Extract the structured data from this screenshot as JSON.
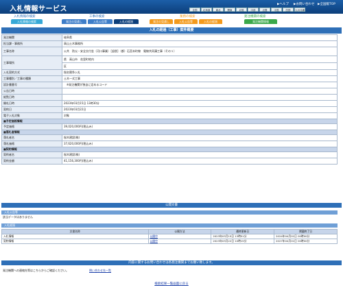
{
  "header": {
    "title": "入札情報サービス",
    "links": [
      "▶ヘルプ",
      "▶お問い合わせ",
      "▶全国版TOP"
    ],
    "regions": [
      "全国",
      "北海道",
      "東北",
      "関東",
      "北陸",
      "中部",
      "近畿",
      "中国",
      "四国",
      "九州沖縄"
    ]
  },
  "tabs": {
    "group_search": "入札情報の検索",
    "group_koji": "工事の検索",
    "group_gyomu": "業務の検索",
    "group_agency": "発注機関の検索",
    "items": [
      "入札情報の検索",
      "発注の見通し",
      "入札公告等",
      "入札の経過",
      "発注の見通し",
      "入札公告等",
      "入札の経過",
      "発注機関情報"
    ]
  },
  "page_title": "入札の経過（工事）案件概要",
  "details": [
    {
      "label": "発注機関",
      "value": "岐阜県"
    },
    {
      "label": "担当課・事務所",
      "value": "高山土木事務所"
    },
    {
      "label": "工事名称",
      "value": "公共　防災・安全交付金（河川事業）［認償］（都）石宮本町線　電線共同溝工事（その１）"
    },
    {
      "label": "工事場所",
      "value": "県　高山市　花里町地内"
    },
    {
      "label": "",
      "value": "区"
    },
    {
      "label": "入札契約方式",
      "value": "指名競争入札"
    },
    {
      "label": "工事種別／工事の種類",
      "value": "土木一式工事"
    },
    {
      "label": "設計書番号",
      "value": "　※発注機関が独自に定めるコード"
    },
    {
      "label": "公告日時",
      "value": ""
    },
    {
      "label": "縦覧日時",
      "value": ""
    },
    {
      "label": "開札日時",
      "value": "2023年03月15日 13時30分"
    },
    {
      "label": "契約日",
      "value": "2023年03月22日"
    },
    {
      "label": "電子入札対象",
      "value": "対象"
    }
  ],
  "sections": {
    "price": "■予定価格情報",
    "winner": "■落札者情報",
    "contract": "■契約情報"
  },
  "price_rows": [
    {
      "label": "予定価格",
      "value": "39,020,000円(税込み)"
    }
  ],
  "winner_rows": [
    {
      "label": "落札者名",
      "value": "桜木建設(株)"
    },
    {
      "label": "落札価格",
      "value": "37,620,000円(税込み)"
    }
  ],
  "contract_rows": [
    {
      "label": "契約者名",
      "value": "桜木建設(株)"
    },
    {
      "label": "契約金額",
      "value": "41,156,300円(税込み)"
    }
  ],
  "public_docs": {
    "title": "公開文書",
    "notice_header": "入札公告等",
    "notice_empty": "該当データはありません",
    "progress_header": "入札経過",
    "columns": [
      "文書名称",
      "公開方法",
      "最終更新日",
      "掲載終了日"
    ],
    "rows": [
      {
        "name": "入札情報",
        "method": "公開中",
        "updated": "2023年03月15日 13時51分",
        "end": "2024年04月01日 00時00分"
      },
      {
        "name": "契約情報",
        "method": "公開中",
        "updated": "2023年03月22日 10時15分",
        "end": "2027年04月01日 00時00分"
      }
    ]
  },
  "inquiry": {
    "title": "内容に関するお問い合わせは各発注機関までお願い致します。",
    "text": "発注機関への連絡先等はこちらからご確認ください。",
    "link": "問い合わせ先一覧"
  },
  "back_link": "検索結果一覧画面に戻る"
}
